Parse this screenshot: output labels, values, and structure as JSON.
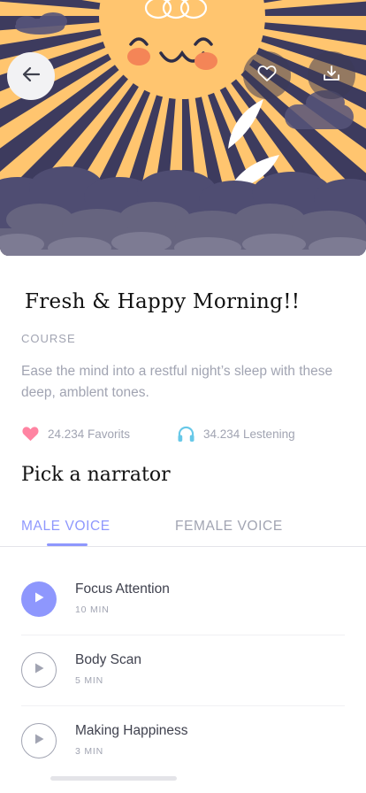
{
  "colors": {
    "accent": "#8e97fd",
    "muted_text": "#a1a4b2",
    "heart": "#ff84a2",
    "headphones": "#67c8e8",
    "sun": "#ffc56f",
    "hero_bg": "#3d3b5e"
  },
  "icons": {
    "back": "arrow-left-icon",
    "favorite": "heart-icon",
    "download": "download-icon",
    "favorites_stat": "heart-icon",
    "listening_stat": "headphones-icon",
    "play": "play-icon"
  },
  "course": {
    "title": "Fresh & Happy Morning!!",
    "type": "COURSE",
    "description": "Ease the mind into a restful night’s sleep  with these deep, amblent tones."
  },
  "stats": {
    "favorites": "24.234 Favorits",
    "listening": "34.234 Lestening"
  },
  "narrator": {
    "heading": "Pick a narrator",
    "tabs": [
      {
        "label": "MALE VOICE",
        "active": true
      },
      {
        "label": "FEMALE VOICE",
        "active": false
      }
    ]
  },
  "tracks": [
    {
      "name": "Focus Attention",
      "duration": "10 MIN",
      "playing": true
    },
    {
      "name": "Body Scan",
      "duration": "5 MIN",
      "playing": false
    },
    {
      "name": "Making Happiness",
      "duration": "3 MIN",
      "playing": false
    }
  ]
}
